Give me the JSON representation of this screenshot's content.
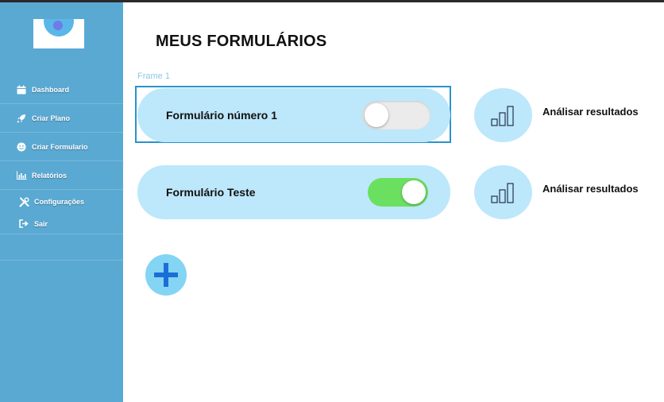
{
  "sidebar": {
    "items": [
      {
        "label": "Dashboard",
        "icon": "calendar-icon"
      },
      {
        "label": "Criar Plano",
        "icon": "rocket-icon"
      },
      {
        "label": "Criar Formulario",
        "icon": "smiley-icon"
      },
      {
        "label": "Relatórios",
        "icon": "bar-chart-icon"
      },
      {
        "label": "Configurações",
        "icon": "tools-icon"
      },
      {
        "label": "Sair",
        "icon": "sign-out-icon"
      }
    ]
  },
  "main": {
    "title": "MEUS FORMULÁRIOS",
    "frame_label": "Frame 1",
    "forms": [
      {
        "name": "Formulário número 1",
        "enabled": false,
        "results_label": "Análisar resultados"
      },
      {
        "name": "Formulário Teste",
        "enabled": true,
        "results_label": "Análisar resultados"
      }
    ],
    "add_button_icon": "plus-icon"
  },
  "colors": {
    "sidebar": "#5aa9d3",
    "card": "#bde7fb",
    "toggle_on": "#6be060",
    "toggle_off": "#ebebeb",
    "add_button": "#84d4f4",
    "plus": "#1a6fd6"
  }
}
